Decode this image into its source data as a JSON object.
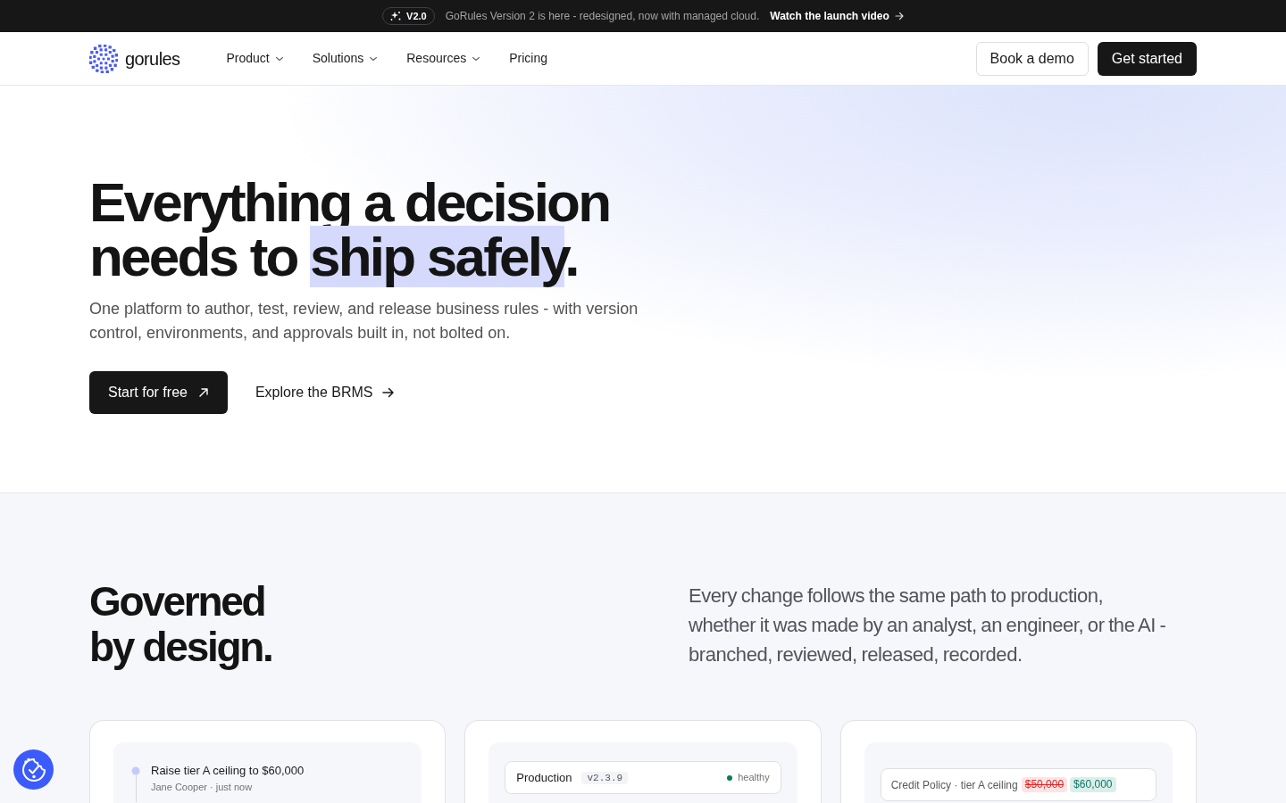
{
  "announcement": {
    "badge": "V2.0",
    "message": "GoRules Version 2 is here - redesigned, now with managed cloud.",
    "link": "Watch the launch video"
  },
  "nav": {
    "logo": "gorules",
    "items": [
      {
        "label": "Product",
        "dropdown": true
      },
      {
        "label": "Solutions",
        "dropdown": true
      },
      {
        "label": "Resources",
        "dropdown": true
      },
      {
        "label": "Pricing",
        "dropdown": false
      }
    ],
    "buttons": [
      {
        "label": "Book a demo",
        "kind": "outline"
      },
      {
        "label": "Get started",
        "kind": "solid"
      }
    ]
  },
  "hero": {
    "title": [
      {
        "text": "Everything a decision needs to ",
        "highlighted": false
      },
      {
        "text": "ship safely",
        "highlighted": true
      },
      {
        "text": ".",
        "highlighted": false
      }
    ],
    "description": "One platform to author, test, review, and release business rules - with version control, environments, and approvals built in, not bolted on.",
    "actions": [
      {
        "label": "Start for free",
        "kind": "primary"
      },
      {
        "label": "Explore the BRMS",
        "kind": "link"
      }
    ]
  },
  "governance": {
    "title": "Governed by design.",
    "description": "Every change follows the same path to production, whether it was made by an analyst, an engineer, or the AI - branched, reviewed, released, recorded.",
    "cards": [
      {
        "kind": "change",
        "title": "Raise tier A ceiling to $60,000",
        "meta": "Jane Cooper · just now"
      },
      {
        "kind": "environment",
        "name": "Production",
        "version": "v2.3.9",
        "status": "healthy"
      },
      {
        "kind": "diff",
        "label": "Credit Policy · tier A ceiling",
        "old_value": "$50,000",
        "new_value": "$60,000"
      }
    ]
  }
}
